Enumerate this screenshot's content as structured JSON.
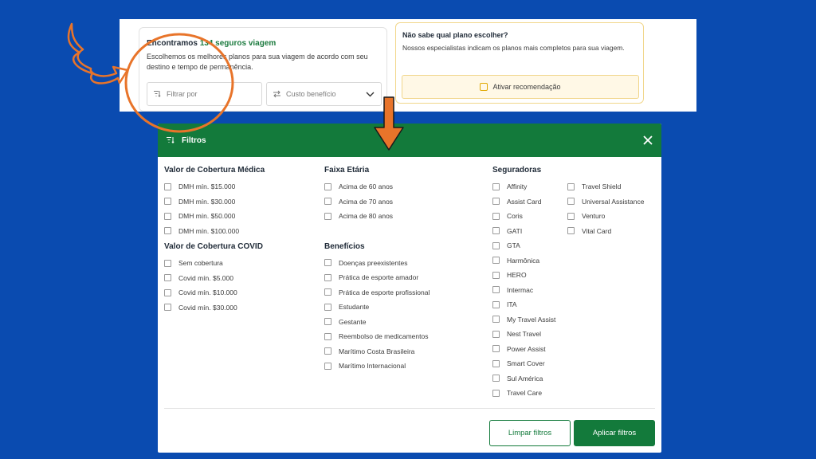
{
  "results": {
    "title_prefix": "Encontramos ",
    "title_highlight": "134 seguros viagem",
    "description": "Escolhemos os melhores planos para sua viagem de acordo com seu destino e tempo de permanência.",
    "filter_placeholder": "Filtrar por",
    "sort_label": "Custo benefício"
  },
  "advice": {
    "title": "Não sabe qual plano escolher?",
    "description": "Nossos especialistas indicam os planos mais completos para sua viagem.",
    "button_label": "Ativar recomendação"
  },
  "modal": {
    "title": "Filtros",
    "medical": {
      "title": "Valor de Cobertura Médica",
      "options": [
        "DMH mín. $15.000",
        "DMH mín. $30.000",
        "DMH mín. $50.000",
        "DMH mín. $100.000"
      ]
    },
    "covid": {
      "title": "Valor de Cobertura COVID",
      "options": [
        "Sem cobertura",
        "Covid mín. $5.000",
        "Covid mín. $10.000",
        "Covid mín. $30.000"
      ]
    },
    "age": {
      "title": "Faixa Etária",
      "options": [
        "Acima de 60 anos",
        "Acima de 70 anos",
        "Acima de 80 anos"
      ]
    },
    "benefits": {
      "title": "Benefícios",
      "options": [
        "Doenças preexistentes",
        "Prática de esporte amador",
        "Prática de esporte profissional",
        "Estudante",
        "Gestante",
        "Reembolso de medicamentos",
        "Marítimo Costa Brasileira",
        "Marítimo Internacional"
      ]
    },
    "insurers": {
      "title": "Seguradoras",
      "options_col1": [
        "Affinity",
        "Assist Card",
        "Coris",
        "GATI",
        "GTA",
        "Harmônica",
        "HERO",
        "Intermac",
        "ITA",
        "My Travel Assist",
        "Nest Travel",
        "Power Assist",
        "Smart Cover",
        "Sul América",
        "Travel Care"
      ],
      "options_col2": [
        "Travel Shield",
        "Universal Assistance",
        "Venturo",
        "Vital Card"
      ]
    },
    "clear_label": "Limpar filtros",
    "apply_label": "Aplicar filtros"
  },
  "colors": {
    "background": "#0a4bb0",
    "brand_green": "#137a3b",
    "annotation_orange": "#e8742a"
  }
}
